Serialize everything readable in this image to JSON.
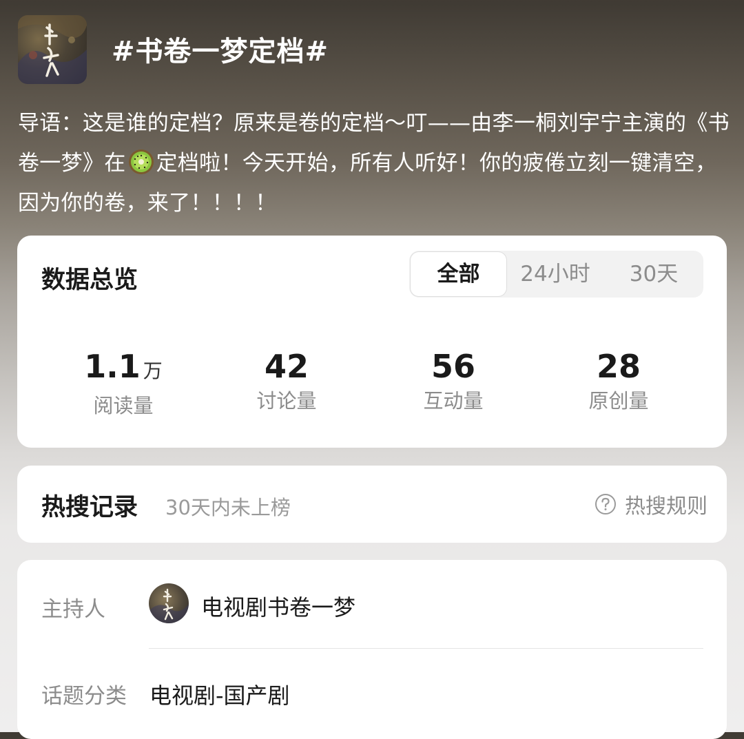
{
  "topic": {
    "cover_icon": "drama-poster-thumbnail",
    "title": "#书卷一梦定档#",
    "intro_before_emoji": "导语：这是谁的定档？原来是卷的定档～叮——由李一桐刘宇宁主演的《书卷一梦》在",
    "emoji_icon": "kiwi-fruit-emoji",
    "intro_after_emoji": "定档啦！今天开始，所有人听好！你的疲倦立刻一键清空，因为你的卷，来了！！！！"
  },
  "overview": {
    "title": "数据总览",
    "tabs": [
      {
        "label": "全部",
        "active": true
      },
      {
        "label": "24小时",
        "active": false
      },
      {
        "label": "30天",
        "active": false
      }
    ],
    "stats": [
      {
        "value": "1.1",
        "unit": "万",
        "label": "阅读量"
      },
      {
        "value": "42",
        "unit": "",
        "label": "讨论量"
      },
      {
        "value": "56",
        "unit": "",
        "label": "互动量"
      },
      {
        "value": "28",
        "unit": "",
        "label": "原创量"
      }
    ]
  },
  "hot_search": {
    "title": "热搜记录",
    "status": "30天内未上榜",
    "rule_icon": "question-circle-icon",
    "rule_label": "热搜规则"
  },
  "info": {
    "host_label": "主持人",
    "host_avatar": "drama-poster-avatar",
    "host_name": "电视剧书卷一梦",
    "category_label": "话题分类",
    "category_value": "电视剧-国产剧"
  },
  "colors": {
    "card_bg": "#ffffff",
    "primary_text": "#1a1a1a",
    "secondary_text": "#8c8c8c",
    "segment_bg": "#f2f2f2"
  }
}
